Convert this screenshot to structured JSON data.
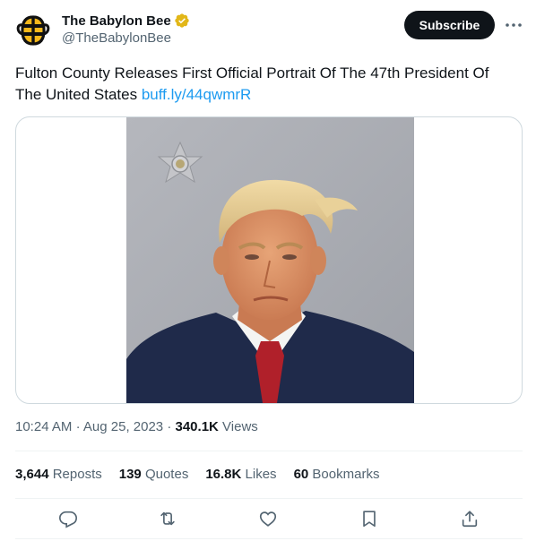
{
  "author": {
    "name": "The Babylon Bee",
    "handle": "@TheBabylonBee",
    "verified_color": "#e2b719"
  },
  "header": {
    "subscribe_label": "Subscribe",
    "more_icon": "more-dots-icon"
  },
  "tweet": {
    "text": "Fulton County Releases First Official Portrait Of The 47th President Of The United States",
    "link": "buff.ly/44qwmrR",
    "image_alt": "Mugshot portrait photo"
  },
  "meta": {
    "time": "10:24 AM",
    "date": "Aug 25, 2023",
    "views_count": "340.1K",
    "views_label": "Views",
    "separator": "·"
  },
  "stats": [
    {
      "count": "3,644",
      "label": "Reposts"
    },
    {
      "count": "139",
      "label": "Quotes"
    },
    {
      "count": "16.8K",
      "label": "Likes"
    },
    {
      "count": "60",
      "label": "Bookmarks"
    }
  ],
  "actions": [
    "reply-icon",
    "repost-icon",
    "like-icon",
    "bookmark-icon",
    "share-icon"
  ],
  "colors": {
    "accent": "#1d9bf0",
    "text": "#0f1419",
    "secondary": "#536471",
    "border": "#cfd9de"
  }
}
